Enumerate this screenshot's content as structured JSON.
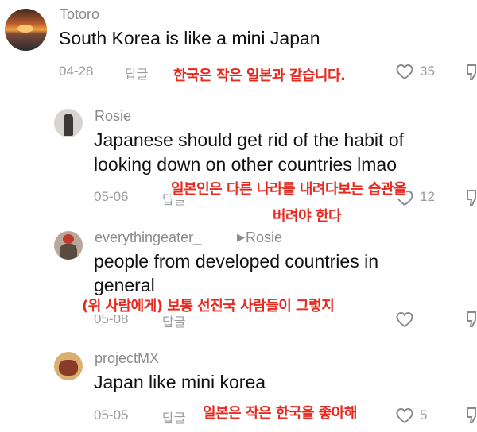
{
  "comments": [
    {
      "user": "Totoro",
      "text": [
        "South Korea is like a mini Japan"
      ],
      "date": "04-28",
      "reply": "답글",
      "translation": [
        "한국은 작은 일본과 같습니다."
      ],
      "likes": "35"
    },
    {
      "user": "Rosie",
      "text": [
        "Japanese should get rid of the habit of",
        "looking down on other countries lmao"
      ],
      "date": "05-06",
      "reply": "답글",
      "translation": [
        "일본인은 다른 나라를 내려다보는 습관을",
        "버려야 한다"
      ],
      "likes": "12"
    },
    {
      "user": "everythingeater_",
      "reply_to": "Rosie",
      "text": [
        "people from developed countries in",
        "general"
      ],
      "date": "05-08",
      "reply": "답글",
      "translation": [
        "(위 사람에게) 보통 선진국 사람들이 그렇지"
      ],
      "likes": ""
    },
    {
      "user": "projectMX",
      "text": [
        "Japan like mini korea"
      ],
      "date": "05-05",
      "reply": "답글",
      "translation": [
        "일본은 작은 한국을 좋아해"
      ],
      "likes": "5"
    }
  ],
  "colors": {
    "annotation": "#e8291f",
    "meta": "#9b9b9b",
    "text": "#111111"
  }
}
